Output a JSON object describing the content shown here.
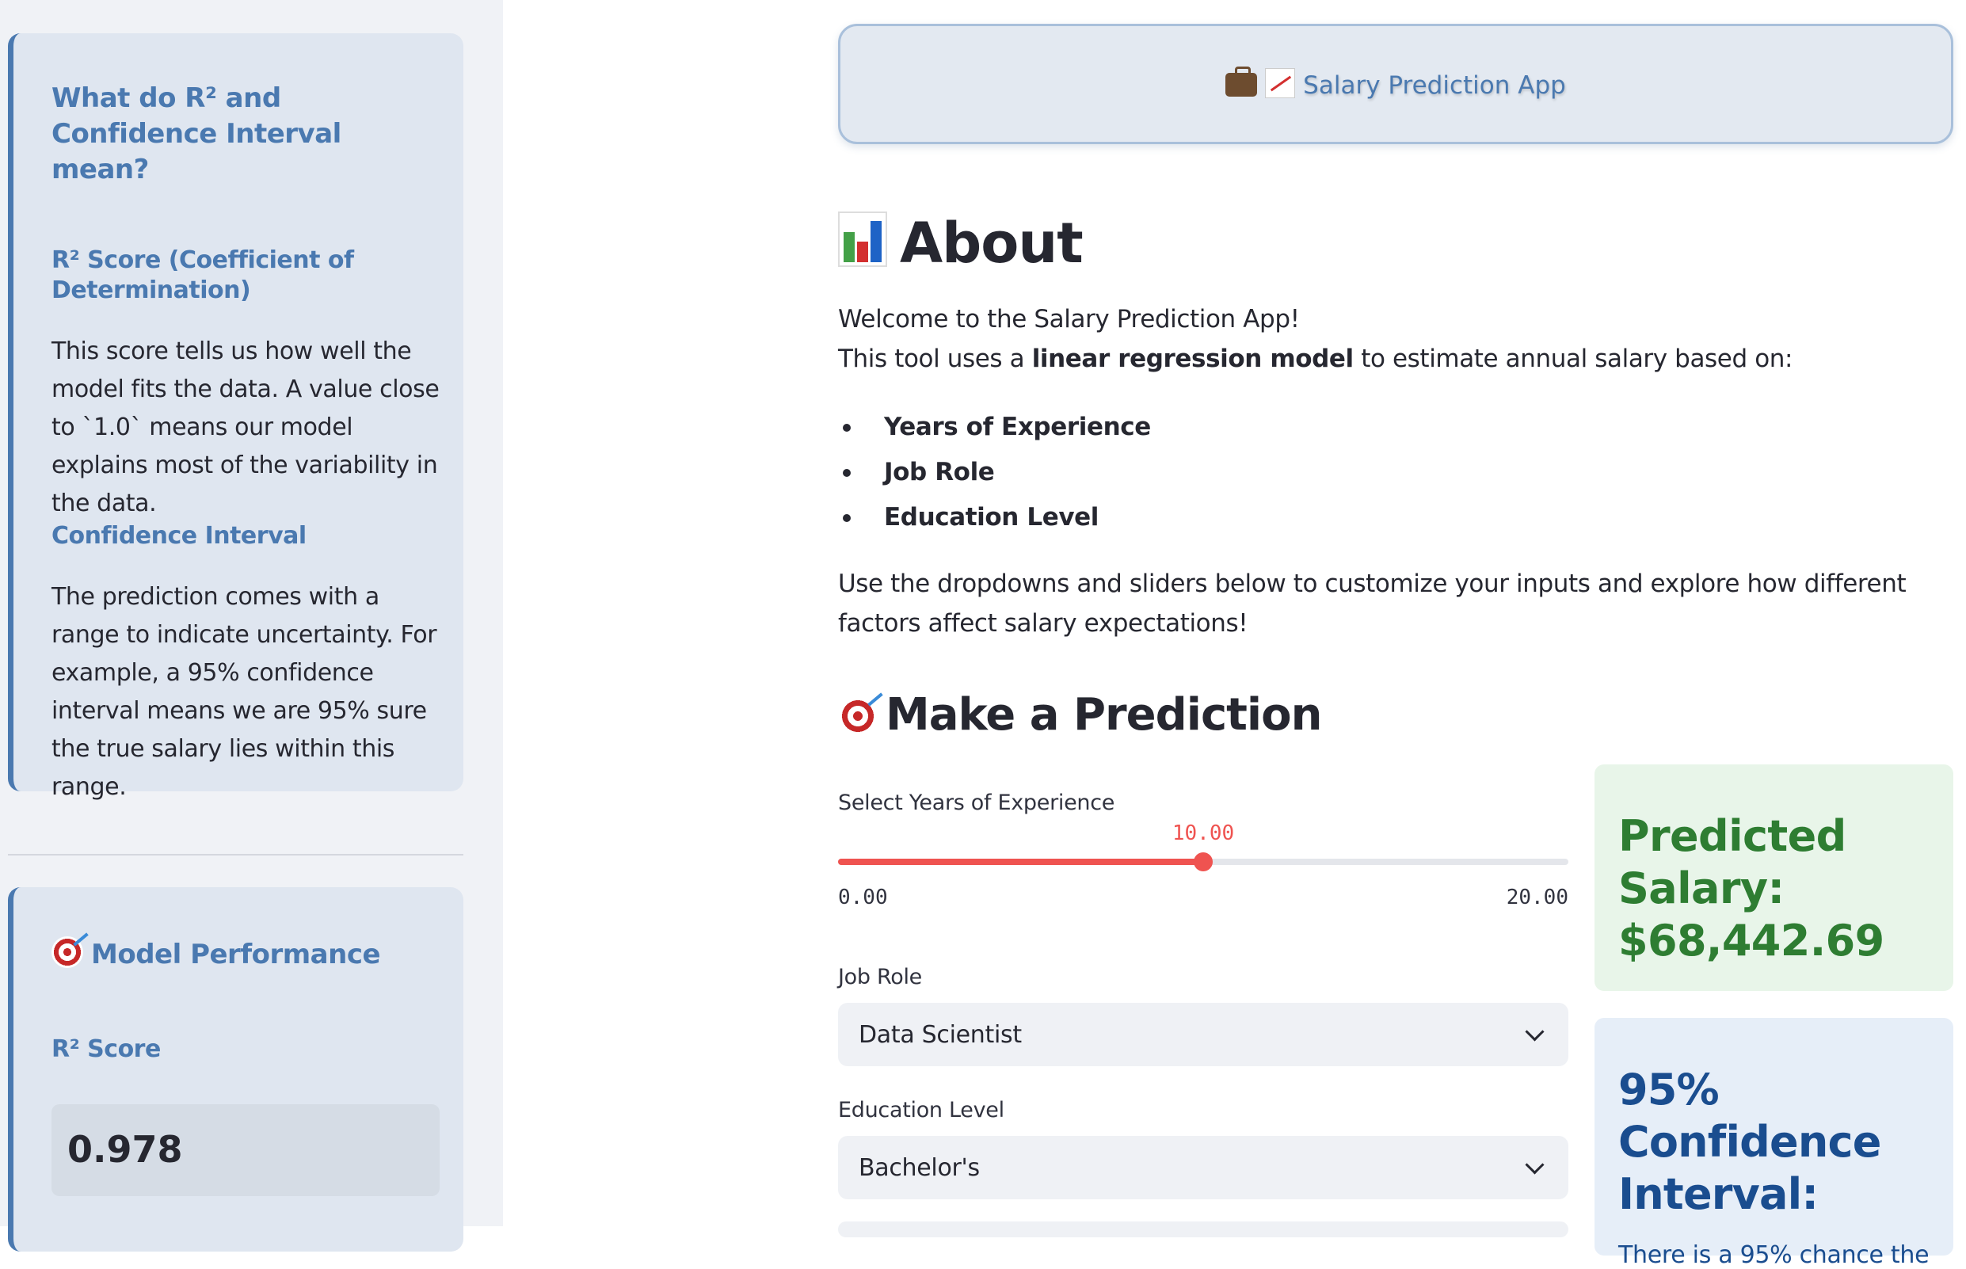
{
  "sidebar": {
    "info_card": {
      "title": "What do R² and Confidence Interval mean?",
      "r2_heading": "R² Score (Coefficient of Determination)",
      "r2_text": "This score tells us how well the model fits the data. A value close to `1.0` means our model explains most of the variability in the data.",
      "ci_heading": "Confidence Interval",
      "ci_text": "The prediction comes with a range to indicate uncertainty. For example, a 95% confidence interval means we are 95% sure the true salary lies within this range."
    },
    "performance_card": {
      "title": "Model Performance",
      "metric_label": "R² Score",
      "metric_value": "0.978"
    }
  },
  "header": {
    "title": "Salary Prediction App"
  },
  "about": {
    "heading": "About",
    "welcome": "Welcome to the Salary Prediction App!",
    "intro_prefix": "This tool uses a ",
    "intro_bold": "linear regression model",
    "intro_suffix": " to estimate annual salary based on:",
    "factors": [
      "Years of Experience",
      "Job Role",
      "Education Level"
    ],
    "instructions": "Use the dropdowns and sliders below to customize your inputs and explore how different factors affect salary expectations!"
  },
  "prediction": {
    "heading": "Make a Prediction",
    "experience_slider": {
      "label": "Select Years of Experience",
      "value": "10.00",
      "min": "0.00",
      "max": "20.00",
      "fraction": 0.5
    },
    "job_role": {
      "label": "Job Role",
      "selected": "Data Scientist"
    },
    "education": {
      "label": "Education Level",
      "selected": "Bachelor's"
    },
    "result": {
      "predicted_label": "Predicted Salary:",
      "predicted_value": "$68,442.69",
      "ci_title": "95% Confidence Interval:",
      "ci_text": "There is a 95% chance the"
    }
  },
  "colors": {
    "accent": "#4a79b0",
    "slider": "#ef5350",
    "success": "#2e7d32"
  }
}
